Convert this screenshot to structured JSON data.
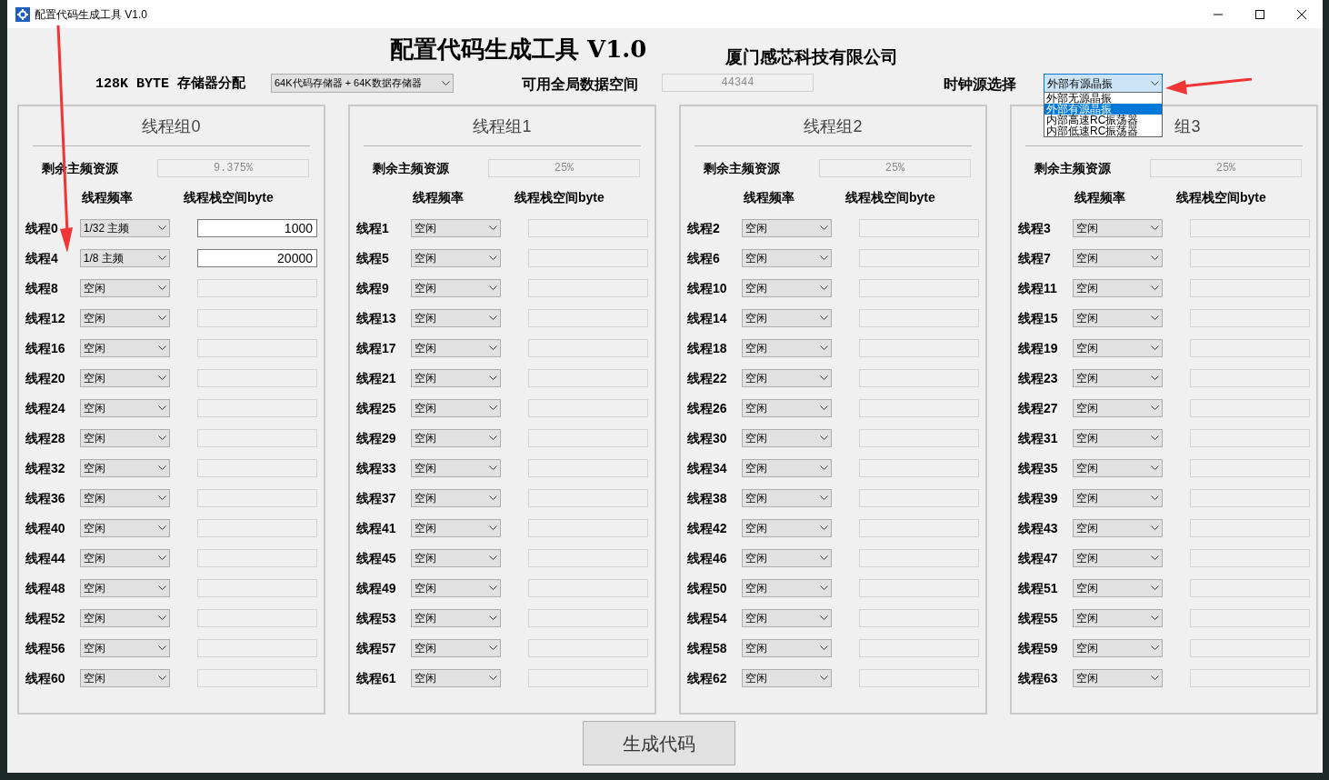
{
  "window": {
    "title": "配置代码生成工具 V1.0"
  },
  "header": {
    "title": "配置代码生成工具 V1.0",
    "company": "厦门感芯科技有限公司"
  },
  "memory": {
    "label": "128K BYTE 存储器分配",
    "value": "64K代码存储器 + 64K数据存储器"
  },
  "global_space": {
    "label": "可用全局数据空间",
    "value": "44344",
    "disabled": true
  },
  "clock": {
    "label": "时钟源选择",
    "value": "外部有源晶振",
    "expanded": true,
    "options": [
      {
        "label": "外部无源晶振",
        "selected": false
      },
      {
        "label": "外部有源晶振",
        "selected": true
      },
      {
        "label": "内部高速RC振荡器",
        "selected": false
      },
      {
        "label": "内部低速RC振荡器",
        "selected": false
      }
    ]
  },
  "groups": [
    {
      "title": "线程组0",
      "remaining_label": "剩余主频资源",
      "remaining": "9.375%",
      "freq_header": "线程频率",
      "stack_header": "线程栈空间byte",
      "threads": [
        {
          "label": "线程0",
          "freq": "1/32 主频",
          "stack": "1000",
          "enabled": true
        },
        {
          "label": "线程4",
          "freq": "1/8 主频",
          "stack": "20000",
          "enabled": true
        },
        {
          "label": "线程8",
          "freq": "空闲",
          "enabled": false
        },
        {
          "label": "线程12",
          "freq": "空闲",
          "enabled": false
        },
        {
          "label": "线程16",
          "freq": "空闲",
          "enabled": false
        },
        {
          "label": "线程20",
          "freq": "空闲",
          "enabled": false
        },
        {
          "label": "线程24",
          "freq": "空闲",
          "enabled": false
        },
        {
          "label": "线程28",
          "freq": "空闲",
          "enabled": false
        },
        {
          "label": "线程32",
          "freq": "空闲",
          "enabled": false
        },
        {
          "label": "线程36",
          "freq": "空闲",
          "enabled": false
        },
        {
          "label": "线程40",
          "freq": "空闲",
          "enabled": false
        },
        {
          "label": "线程44",
          "freq": "空闲",
          "enabled": false
        },
        {
          "label": "线程48",
          "freq": "空闲",
          "enabled": false
        },
        {
          "label": "线程52",
          "freq": "空闲",
          "enabled": false
        },
        {
          "label": "线程56",
          "freq": "空闲",
          "enabled": false
        },
        {
          "label": "线程60",
          "freq": "空闲",
          "enabled": false
        }
      ]
    },
    {
      "title": "线程组1",
      "remaining_label": "剩余主频资源",
      "remaining": "25%",
      "freq_header": "线程频率",
      "stack_header": "线程栈空间byte",
      "threads": [
        {
          "label": "线程1",
          "freq": "空闲",
          "enabled": false
        },
        {
          "label": "线程5",
          "freq": "空闲",
          "enabled": false
        },
        {
          "label": "线程9",
          "freq": "空闲",
          "enabled": false
        },
        {
          "label": "线程13",
          "freq": "空闲",
          "enabled": false
        },
        {
          "label": "线程17",
          "freq": "空闲",
          "enabled": false
        },
        {
          "label": "线程21",
          "freq": "空闲",
          "enabled": false
        },
        {
          "label": "线程25",
          "freq": "空闲",
          "enabled": false
        },
        {
          "label": "线程29",
          "freq": "空闲",
          "enabled": false
        },
        {
          "label": "线程33",
          "freq": "空闲",
          "enabled": false
        },
        {
          "label": "线程37",
          "freq": "空闲",
          "enabled": false
        },
        {
          "label": "线程41",
          "freq": "空闲",
          "enabled": false
        },
        {
          "label": "线程45",
          "freq": "空闲",
          "enabled": false
        },
        {
          "label": "线程49",
          "freq": "空闲",
          "enabled": false
        },
        {
          "label": "线程53",
          "freq": "空闲",
          "enabled": false
        },
        {
          "label": "线程57",
          "freq": "空闲",
          "enabled": false
        },
        {
          "label": "线程61",
          "freq": "空闲",
          "enabled": false
        }
      ]
    },
    {
      "title": "线程组2",
      "remaining_label": "剩余主频资源",
      "remaining": "25%",
      "freq_header": "线程频率",
      "stack_header": "线程栈空间byte",
      "threads": [
        {
          "label": "线程2",
          "freq": "空闲",
          "enabled": false
        },
        {
          "label": "线程6",
          "freq": "空闲",
          "enabled": false
        },
        {
          "label": "线程10",
          "freq": "空闲",
          "enabled": false
        },
        {
          "label": "线程14",
          "freq": "空闲",
          "enabled": false
        },
        {
          "label": "线程18",
          "freq": "空闲",
          "enabled": false
        },
        {
          "label": "线程22",
          "freq": "空闲",
          "enabled": false
        },
        {
          "label": "线程26",
          "freq": "空闲",
          "enabled": false
        },
        {
          "label": "线程30",
          "freq": "空闲",
          "enabled": false
        },
        {
          "label": "线程34",
          "freq": "空闲",
          "enabled": false
        },
        {
          "label": "线程38",
          "freq": "空闲",
          "enabled": false
        },
        {
          "label": "线程42",
          "freq": "空闲",
          "enabled": false
        },
        {
          "label": "线程46",
          "freq": "空闲",
          "enabled": false
        },
        {
          "label": "线程50",
          "freq": "空闲",
          "enabled": false
        },
        {
          "label": "线程54",
          "freq": "空闲",
          "enabled": false
        },
        {
          "label": "线程58",
          "freq": "空闲",
          "enabled": false
        },
        {
          "label": "线程62",
          "freq": "空闲",
          "enabled": false
        }
      ]
    },
    {
      "title": "组3",
      "remaining_label": "剩余主频资源",
      "remaining": "25%",
      "freq_header": "线程频率",
      "stack_header": "线程栈空间byte",
      "threads": [
        {
          "label": "线程3",
          "freq": "空闲",
          "enabled": false
        },
        {
          "label": "线程7",
          "freq": "空闲",
          "enabled": false
        },
        {
          "label": "线程11",
          "freq": "空闲",
          "enabled": false
        },
        {
          "label": "线程15",
          "freq": "空闲",
          "enabled": false
        },
        {
          "label": "线程19",
          "freq": "空闲",
          "enabled": false
        },
        {
          "label": "线程23",
          "freq": "空闲",
          "enabled": false
        },
        {
          "label": "线程27",
          "freq": "空闲",
          "enabled": false
        },
        {
          "label": "线程31",
          "freq": "空闲",
          "enabled": false
        },
        {
          "label": "线程35",
          "freq": "空闲",
          "enabled": false
        },
        {
          "label": "线程39",
          "freq": "空闲",
          "enabled": false
        },
        {
          "label": "线程43",
          "freq": "空闲",
          "enabled": false
        },
        {
          "label": "线程47",
          "freq": "空闲",
          "enabled": false
        },
        {
          "label": "线程51",
          "freq": "空闲",
          "enabled": false
        },
        {
          "label": "线程55",
          "freq": "空闲",
          "enabled": false
        },
        {
          "label": "线程59",
          "freq": "空闲",
          "enabled": false
        },
        {
          "label": "线程63",
          "freq": "空闲",
          "enabled": false
        }
      ]
    }
  ],
  "generate_button": "生成代码"
}
